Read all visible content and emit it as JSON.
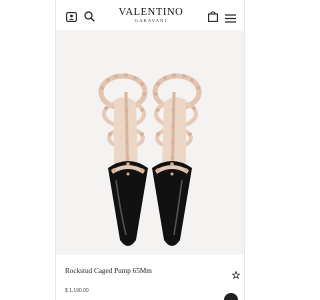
{
  "brand": {
    "name": "VALENTINO",
    "sub": "GARAVANI"
  },
  "header": {
    "left_icons": [
      "account-icon",
      "search-icon"
    ],
    "right_icons": [
      "shopping-bag-icon",
      "menu-icon"
    ]
  },
  "product": {
    "name": "Rockstud Caged Pump 65Mm",
    "price": "$ 1,190.00",
    "image": "pair-of-black-and-nude-studded-caged-pumps"
  },
  "colors": {
    "accent": "#111111",
    "image_background": "#f5f3f2",
    "nude": "#e8cdbb",
    "stud": "#d9b69f"
  }
}
